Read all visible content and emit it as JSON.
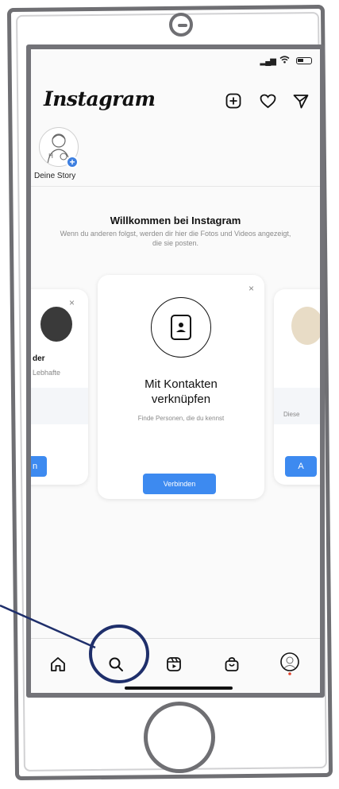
{
  "app": {
    "name": "Instagram"
  },
  "header": {
    "logo_text": "Instagram",
    "icons": [
      "add-post-icon",
      "heart-icon",
      "direct-message-icon"
    ]
  },
  "stories": {
    "own_story_label": "Deine Story"
  },
  "welcome": {
    "title": "Willkommen bei Instagram",
    "subtitle": "Wenn du anderen folgst, werden dir hier die Fotos und Videos angezeigt, die sie posten."
  },
  "cards": {
    "left": {
      "name_fragment": "der",
      "desc_fragment": "Lebhafte",
      "button_fragment": "n"
    },
    "main": {
      "title_line1": "Mit Kontakten",
      "title_line2": "verknüpfen",
      "description": "Finde Personen, die du kennst",
      "button_label": "Verbinden",
      "close_symbol": "×"
    },
    "right": {
      "text_fragment": "Diese",
      "button_fragment": "A"
    }
  },
  "tabbar": {
    "tabs": [
      "home-icon",
      "search-icon",
      "reels-icon",
      "shop-icon",
      "profile-avatar"
    ],
    "highlighted": "search-icon"
  },
  "colors": {
    "accent_blue": "#3d8af0",
    "callout_navy": "#1f2f6b",
    "frame_gray": "#6f6f73"
  }
}
